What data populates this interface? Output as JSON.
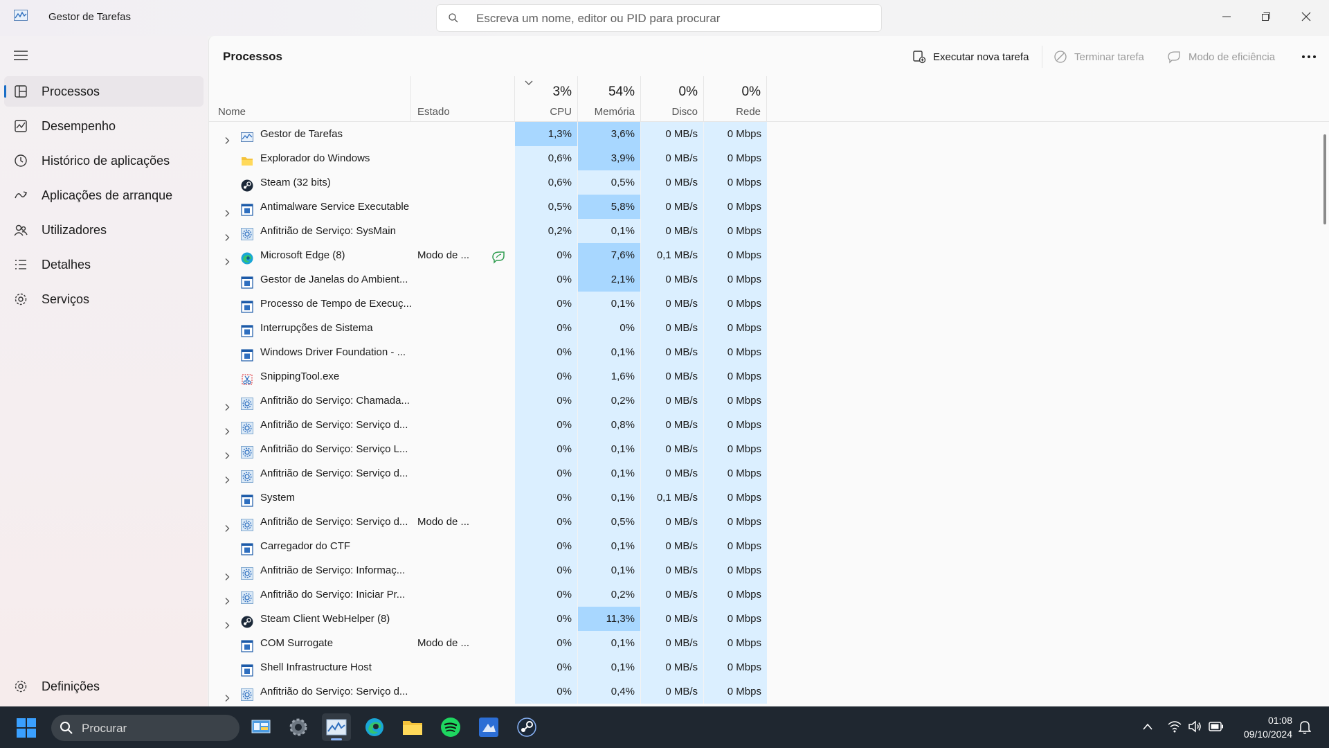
{
  "window": {
    "title": "Gestor de Tarefas",
    "search_placeholder": "Escreva um nome, editor ou PID para procurar"
  },
  "sidebar": {
    "items": [
      {
        "label": "Processos",
        "icon": "processes-icon",
        "active": true
      },
      {
        "label": "Desempenho",
        "icon": "performance-icon"
      },
      {
        "label": "Histórico de aplicações",
        "icon": "app-history-icon"
      },
      {
        "label": "Aplicações de arranque",
        "icon": "startup-apps-icon"
      },
      {
        "label": "Utilizadores",
        "icon": "users-icon"
      },
      {
        "label": "Detalhes",
        "icon": "details-icon"
      },
      {
        "label": "Serviços",
        "icon": "services-icon"
      }
    ],
    "settings_label": "Definições"
  },
  "main": {
    "title": "Processos",
    "toolbar": {
      "run_task": "Executar nova tarefa",
      "end_task": "Terminar tarefa",
      "efficiency": "Modo de eficiência"
    }
  },
  "table": {
    "columns": {
      "name": "Nome",
      "status": "Estado",
      "cpu": {
        "label": "CPU",
        "total": "3%"
      },
      "memory": {
        "label": "Memória",
        "total": "54%"
      },
      "disk": {
        "label": "Disco",
        "total": "0%"
      },
      "network": {
        "label": "Rede",
        "total": "0%"
      }
    },
    "rows": [
      {
        "name": "Gestor de Tarefas",
        "expand": true,
        "icon": "taskmgr",
        "status": "",
        "cpu": "1,3%",
        "mem": "3,6%",
        "disk": "0 MB/s",
        "net": "0 Mbps",
        "hl_cpu": true,
        "hl_mem": true
      },
      {
        "name": "Explorador do Windows",
        "expand": false,
        "icon": "folder",
        "status": "",
        "cpu": "0,6%",
        "mem": "3,9%",
        "disk": "0 MB/s",
        "net": "0 Mbps",
        "hl_mem": true
      },
      {
        "name": "Steam (32 bits)",
        "expand": false,
        "icon": "steam",
        "status": "",
        "cpu": "0,6%",
        "mem": "0,5%",
        "disk": "0 MB/s",
        "net": "0 Mbps"
      },
      {
        "name": "Antimalware Service Executable",
        "expand": true,
        "icon": "window",
        "status": "",
        "cpu": "0,5%",
        "mem": "5,8%",
        "disk": "0 MB/s",
        "net": "0 Mbps",
        "hl_mem": true
      },
      {
        "name": "Anfitrião de Serviço: SysMain",
        "expand": true,
        "icon": "gear",
        "status": "",
        "cpu": "0,2%",
        "mem": "0,1%",
        "disk": "0 MB/s",
        "net": "0 Mbps"
      },
      {
        "name": "Microsoft Edge (8)",
        "expand": true,
        "icon": "edge",
        "status": "Modo de ...",
        "leaf": true,
        "cpu": "0%",
        "mem": "7,6%",
        "disk": "0,1 MB/s",
        "net": "0 Mbps",
        "hl_mem": true
      },
      {
        "name": "Gestor de Janelas do Ambient...",
        "expand": false,
        "icon": "window",
        "status": "",
        "cpu": "0%",
        "mem": "2,1%",
        "disk": "0 MB/s",
        "net": "0 Mbps",
        "hl_mem": true
      },
      {
        "name": "Processo de Tempo de Execuç...",
        "expand": false,
        "icon": "window",
        "status": "",
        "cpu": "0%",
        "mem": "0,1%",
        "disk": "0 MB/s",
        "net": "0 Mbps"
      },
      {
        "name": "Interrupções de Sistema",
        "expand": false,
        "icon": "window",
        "status": "",
        "cpu": "0%",
        "mem": "0%",
        "disk": "0 MB/s",
        "net": "0 Mbps"
      },
      {
        "name": "Windows Driver Foundation - ...",
        "expand": false,
        "icon": "window",
        "status": "",
        "cpu": "0%",
        "mem": "0,1%",
        "disk": "0 MB/s",
        "net": "0 Mbps"
      },
      {
        "name": "SnippingTool.exe",
        "expand": false,
        "icon": "snip",
        "status": "",
        "cpu": "0%",
        "mem": "1,6%",
        "disk": "0 MB/s",
        "net": "0 Mbps"
      },
      {
        "name": "Anfitrião do Serviço: Chamada...",
        "expand": true,
        "icon": "gear",
        "status": "",
        "cpu": "0%",
        "mem": "0,2%",
        "disk": "0 MB/s",
        "net": "0 Mbps"
      },
      {
        "name": "Anfitrião de Serviço: Serviço d...",
        "expand": true,
        "icon": "gear",
        "status": "",
        "cpu": "0%",
        "mem": "0,8%",
        "disk": "0 MB/s",
        "net": "0 Mbps"
      },
      {
        "name": "Anfitrião do Serviço: Serviço L...",
        "expand": true,
        "icon": "gear",
        "status": "",
        "cpu": "0%",
        "mem": "0,1%",
        "disk": "0 MB/s",
        "net": "0 Mbps"
      },
      {
        "name": "Anfitrião de Serviço: Serviço d...",
        "expand": true,
        "icon": "gear",
        "status": "",
        "cpu": "0%",
        "mem": "0,1%",
        "disk": "0 MB/s",
        "net": "0 Mbps"
      },
      {
        "name": "System",
        "expand": false,
        "icon": "window",
        "status": "",
        "cpu": "0%",
        "mem": "0,1%",
        "disk": "0,1 MB/s",
        "net": "0 Mbps"
      },
      {
        "name": "Anfitrião de Serviço: Serviço d...",
        "expand": true,
        "icon": "gear",
        "status": "Modo de ...",
        "cpu": "0%",
        "mem": "0,5%",
        "disk": "0 MB/s",
        "net": "0 Mbps"
      },
      {
        "name": "Carregador do CTF",
        "expand": false,
        "icon": "window",
        "status": "",
        "cpu": "0%",
        "mem": "0,1%",
        "disk": "0 MB/s",
        "net": "0 Mbps"
      },
      {
        "name": "Anfitrião de Serviço: Informaç...",
        "expand": true,
        "icon": "gear",
        "status": "",
        "cpu": "0%",
        "mem": "0,1%",
        "disk": "0 MB/s",
        "net": "0 Mbps"
      },
      {
        "name": "Anfitrião do Serviço: Iniciar Pr...",
        "expand": true,
        "icon": "gear",
        "status": "",
        "cpu": "0%",
        "mem": "0,2%",
        "disk": "0 MB/s",
        "net": "0 Mbps"
      },
      {
        "name": "Steam Client WebHelper (8)",
        "expand": true,
        "icon": "steam",
        "status": "",
        "cpu": "0%",
        "mem": "11,3%",
        "disk": "0 MB/s",
        "net": "0 Mbps",
        "hl_mem": true
      },
      {
        "name": "COM Surrogate",
        "expand": false,
        "icon": "window",
        "status": "Modo de ...",
        "cpu": "0%",
        "mem": "0,1%",
        "disk": "0 MB/s",
        "net": "0 Mbps"
      },
      {
        "name": "Shell Infrastructure Host",
        "expand": false,
        "icon": "window",
        "status": "",
        "cpu": "0%",
        "mem": "0,1%",
        "disk": "0 MB/s",
        "net": "0 Mbps"
      },
      {
        "name": "Anfitrião do Serviço: Serviço d...",
        "expand": true,
        "icon": "gear",
        "status": "",
        "cpu": "0%",
        "mem": "0,4%",
        "disk": "0 MB/s",
        "net": "0 Mbps"
      }
    ]
  },
  "taskbar": {
    "search_placeholder": "Procurar",
    "time": "01:08",
    "date": "09/10/2024"
  }
}
